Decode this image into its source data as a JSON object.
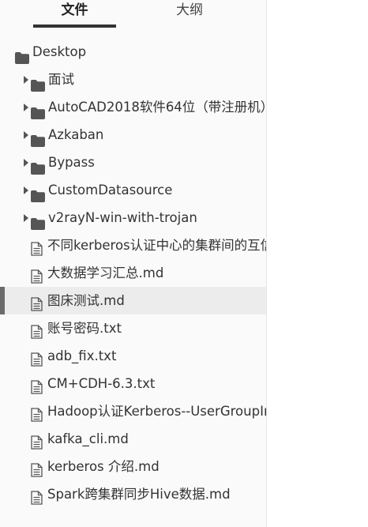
{
  "tabs": {
    "file": "文件",
    "outline": "大纲"
  },
  "root": {
    "label": "Desktop",
    "icon": "folder-icon"
  },
  "folders": [
    {
      "label": "面试",
      "icon": "folder-icon"
    },
    {
      "label": "AutoCAD2018软件64位（带注册机）",
      "icon": "folder-icon"
    },
    {
      "label": "Azkaban",
      "icon": "folder-icon"
    },
    {
      "label": "Bypass",
      "icon": "folder-icon"
    },
    {
      "label": "CustomDatasource",
      "icon": "folder-icon"
    },
    {
      "label": "v2rayN-win-with-trojan",
      "icon": "folder-icon"
    }
  ],
  "files": [
    {
      "label": "不同kerberos认证中心的集群间的互信",
      "icon": "file-icon",
      "active": false
    },
    {
      "label": "大数据学习汇总.md",
      "icon": "file-icon",
      "active": false
    },
    {
      "label": "图床测试.md",
      "icon": "file-icon",
      "active": true
    },
    {
      "label": "账号密码.txt",
      "icon": "file-icon",
      "active": false
    },
    {
      "label": "adb_fix.txt",
      "icon": "file-icon",
      "active": false
    },
    {
      "label": "CM+CDH-6.3.txt",
      "icon": "file-icon",
      "active": false
    },
    {
      "label": "Hadoop认证Kerberos--UserGroupInformation",
      "icon": "file-icon",
      "active": false
    },
    {
      "label": "kafka_cli.md",
      "icon": "file-icon",
      "active": false
    },
    {
      "label": "kerberos 介绍.md",
      "icon": "file-icon",
      "active": false
    },
    {
      "label": "Spark跨集群同步Hive数据.md",
      "icon": "file-icon",
      "active": false
    }
  ],
  "colors": {
    "sidebar_bg": "#fafafa",
    "active_row": "#ececec",
    "active_bar": "#6b6b6b",
    "text": "#333333"
  }
}
